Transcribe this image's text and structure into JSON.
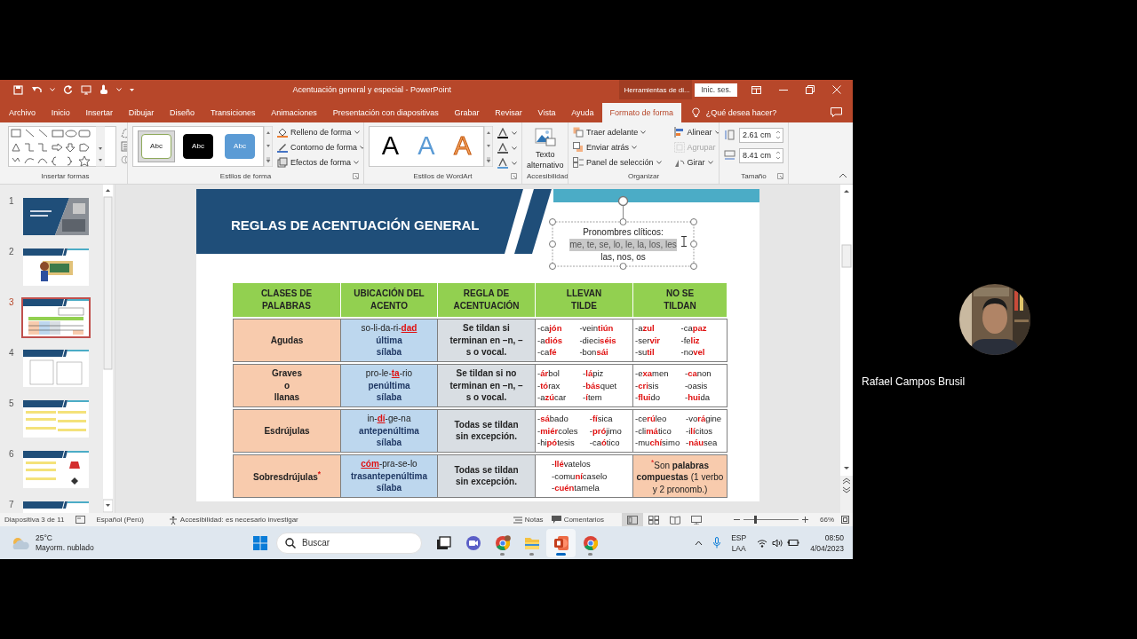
{
  "window": {
    "title": "Acentuación general y especial  -  PowerPoint",
    "context_tab": "Herramientas de di...",
    "sign_in": "Inic. ses."
  },
  "tabs": [
    {
      "label": "Archivo",
      "selected": false
    },
    {
      "label": "Inicio",
      "selected": false
    },
    {
      "label": "Insertar",
      "selected": false
    },
    {
      "label": "Dibujar",
      "selected": false
    },
    {
      "label": "Diseño",
      "selected": false
    },
    {
      "label": "Transiciones",
      "selected": false
    },
    {
      "label": "Animaciones",
      "selected": false
    },
    {
      "label": "Presentación con diapositivas",
      "selected": false
    },
    {
      "label": "Grabar",
      "selected": false
    },
    {
      "label": "Revisar",
      "selected": false
    },
    {
      "label": "Vista",
      "selected": false
    },
    {
      "label": "Ayuda",
      "selected": false
    },
    {
      "label": "Formato de forma",
      "selected": true
    }
  ],
  "tell_me": "¿Qué desea hacer?",
  "ribbon": {
    "groups": [
      {
        "kind": "shapes",
        "label": "Insertar formas"
      },
      {
        "kind": "shape_styles",
        "label": "Estilos de forma",
        "styles": [
          {
            "label": "Abc",
            "color": "#ffffff",
            "selected": true
          },
          {
            "label": "Abc",
            "color": "#000000",
            "selected": false
          },
          {
            "label": "Abc",
            "color": "#5b9bd5",
            "selected": false
          }
        ],
        "commands": [
          "Relleno de forma",
          "Contorno de forma",
          "Efectos de forma"
        ]
      },
      {
        "kind": "wordart",
        "label": "Estilos de WordArt",
        "styles": [
          {
            "label": "A",
            "color": "#000000"
          },
          {
            "label": "A",
            "color": "#5b9bd5"
          },
          {
            "label": "A",
            "color": "#f4a460"
          }
        ]
      },
      {
        "kind": "accessibility",
        "label": "Accesibilidad",
        "command": "Texto alternativo"
      },
      {
        "kind": "arrange",
        "label": "Organizar",
        "commands": [
          {
            "label": "Traer adelante",
            "disabled": false
          },
          {
            "label": "Alinear",
            "disabled": false
          },
          {
            "label": "Enviar atrás",
            "disabled": false
          },
          {
            "label": "Agrupar",
            "disabled": true
          },
          {
            "label": "Panel de selección",
            "disabled": false
          },
          {
            "label": "Girar",
            "disabled": false
          }
        ]
      },
      {
        "kind": "size",
        "label": "Tamaño",
        "fields": [
          "2.61 cm",
          "8.41 cm"
        ]
      }
    ]
  },
  "slides": [
    {
      "number": "1",
      "selected": false
    },
    {
      "number": "2",
      "selected": false
    },
    {
      "number": "3",
      "selected": true
    },
    {
      "number": "4",
      "selected": false
    },
    {
      "number": "5",
      "selected": false
    },
    {
      "number": "6",
      "selected": false
    },
    {
      "number": "7",
      "selected": false
    }
  ],
  "slide": {
    "title": "REGLAS DE ACENTUACIÓN GENERAL",
    "textbox": {
      "title": "Pronombres clíticos:",
      "lines": [
        {
          "text": "me, te, se, lo, le, la, los, les",
          "selected": true
        },
        {
          "text": "las, nos, os",
          "selected": false
        }
      ]
    },
    "table": {
      "columns": [
        "CLASES DE\nPALABRAS",
        "UBICACIÓN DEL\nACENTO",
        "REGLA DE\nACENTUACIÓN",
        "LLEVAN\nTILDE",
        "NO SE\nTILDAN"
      ],
      "rows": [
        {
          "class": "Agudas",
          "split": "so-li-da-ri-**dad**",
          "position": [
            "última",
            "sílaba"
          ],
          "rule": "Se tildan si terminan en –n, – s o vocal.",
          "with_accent": [
            [
              "-ca**jón**",
              "-vein**tiún**"
            ],
            [
              "-a**diós**",
              "-dieci**séis**"
            ],
            [
              "-ca**fé**",
              "-bon**sái**"
            ]
          ],
          "without_accent": {
            "kind": "examples",
            "lines": [
              [
                "-a**zul**",
                "-ca**paz**"
              ],
              [
                "-ser**vir**",
                "-fe**liz**"
              ],
              [
                "-su**til**",
                "-no**vel**"
              ]
            ]
          }
        },
        {
          "class": "Graves\no\nllanas",
          "split": "pro-le-**ta**-rio",
          "position": [
            "penúltima",
            "sílaba"
          ],
          "rule": "Se tildan si no terminan en –n, – s o vocal.",
          "with_accent": [
            [
              "-**ár**bol",
              "-**lá**piz"
            ],
            [
              "-**tó**rax",
              "-**bás**quet"
            ],
            [
              "-a**zú**car",
              "-**í**tem"
            ]
          ],
          "without_accent": {
            "kind": "examples",
            "lines": [
              [
                "-e**xa**men",
                "-**ca**non"
              ],
              [
                "-**cri**sis",
                "-oasis"
              ],
              [
                "-**flui**do",
                "-**hui**da"
              ]
            ]
          }
        },
        {
          "class": "Esdrújulas",
          "split": "in-**dí**-ge-na",
          "position": [
            "antepenúltima",
            "sílaba"
          ],
          "rule": "Todas se tildan sin excepción.",
          "with_accent": [
            [
              "-**sá**bado",
              "-**fí**sica"
            ],
            [
              "-**miér**coles",
              "-**pró**jimo"
            ],
            [
              "-hi**pó**tesis",
              "-ca**ó**tico"
            ]
          ],
          "without_accent": {
            "kind": "examples",
            "lines": [
              [
                "-ce**rú**leo",
                "-vo**rá**gine"
              ],
              [
                "-cli**má**tico",
                "-i**lí**citos"
              ],
              [
                "-mu**chí**simo",
                "-**náu**sea"
              ]
            ]
          }
        },
        {
          "class": "Sobresdrújulas$^{*}$",
          "split": "**cóm**-pra-se-lo",
          "position": [
            "trasantepenúltima",
            "sílaba"
          ],
          "rule": "Todas se tildan sin excepción.",
          "with_accent": [
            [
              "-**llé**vatelos"
            ],
            [
              "-comu**ní**caselo"
            ],
            [
              "-**cuén**tamela"
            ]
          ],
          "without_accent": {
            "kind": "note",
            "text": "$^{*}$Son **palabras compuestas** (1 verbo y 2 pronomb.)"
          }
        }
      ]
    }
  },
  "status_bar": {
    "slide_info": "Diapositiva 3 de 11",
    "language": "Español (Perú)",
    "accessibility": "Accesibilidad: es necesario investigar",
    "notes": "Notas",
    "comments": "Comentarios",
    "views": [
      {
        "selected": true
      },
      {
        "selected": false
      },
      {
        "selected": false
      },
      {
        "selected": false
      }
    ],
    "zoom": {
      "level": 0.2,
      "label": "66%"
    }
  },
  "taskbar": {
    "weather": {
      "temperature": "25°C",
      "condition": "Mayorm. nublado"
    },
    "search": {
      "placeholder": "Buscar"
    },
    "apps": [
      {
        "kind": "task_view",
        "running": false,
        "selected": false
      },
      {
        "kind": "video_call",
        "running": false,
        "selected": false
      },
      {
        "kind": "browser_profile",
        "running": true,
        "selected": false
      },
      {
        "kind": "folder",
        "running": true,
        "selected": false
      },
      {
        "kind": "presentation",
        "running": true,
        "selected": true
      },
      {
        "kind": "browser",
        "running": true,
        "selected": false
      }
    ],
    "input_language": [
      "ESP",
      "LAA"
    ],
    "time": "08:50",
    "date": "4/04/2023"
  },
  "participant": {
    "name": "Rafael Campos Brusil"
  }
}
